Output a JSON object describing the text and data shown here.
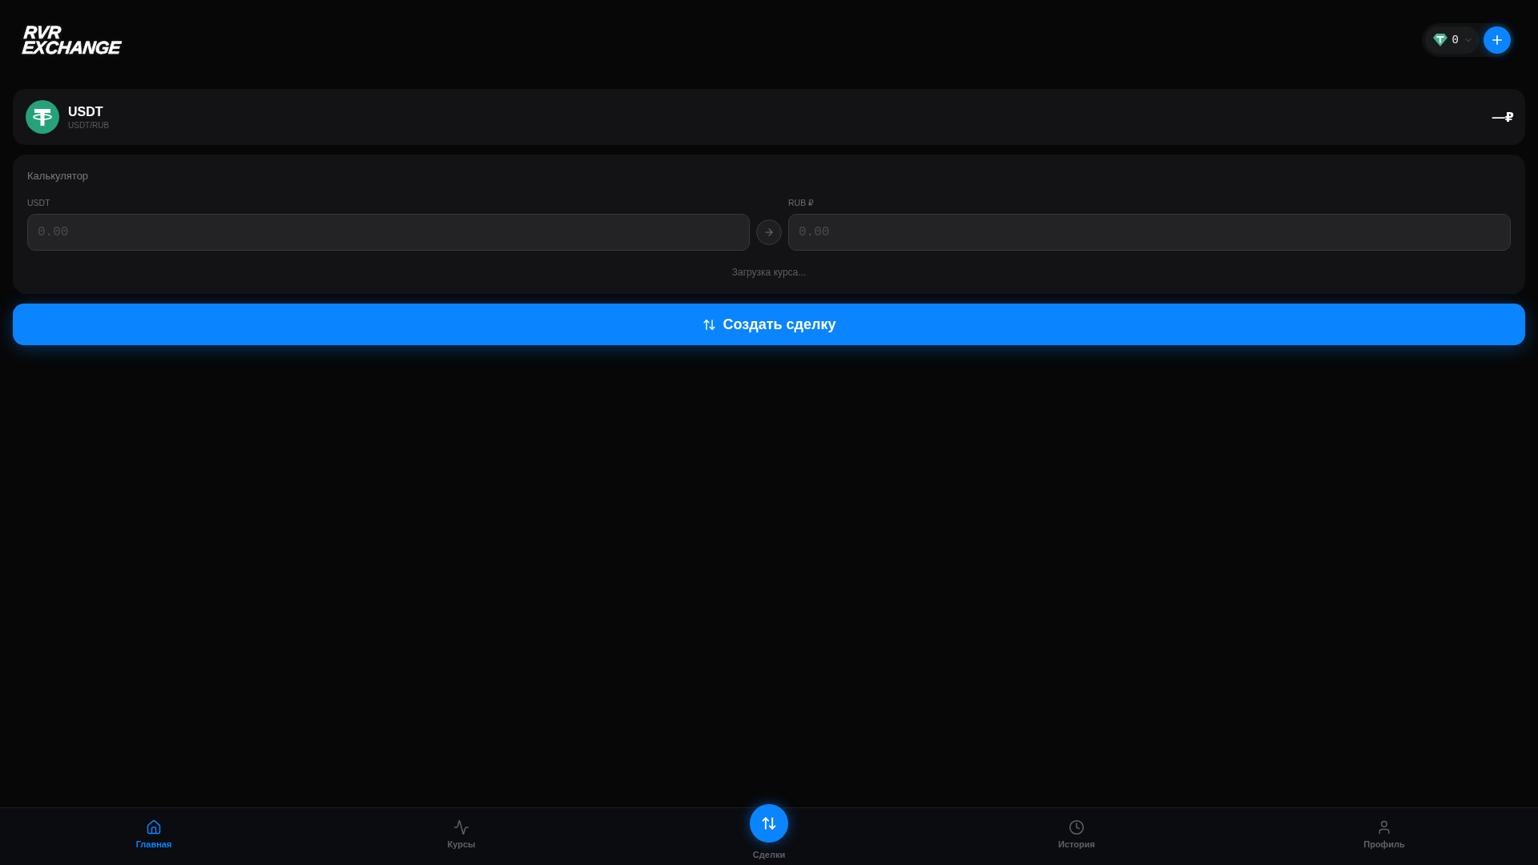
{
  "header": {
    "logo": [
      "RVR",
      "EXCHANGE"
    ],
    "balance": "0"
  },
  "pair": {
    "symbol": "USDT",
    "subtitle": "USDT/RUB",
    "rate": "—₽"
  },
  "calculator": {
    "title": "Калькулятор",
    "fields": [
      {
        "label": "USDT",
        "placeholder": "0.00"
      },
      {
        "label": "RUB ₽",
        "placeholder": "0.00"
      }
    ],
    "status": "Загрузка курса..."
  },
  "create_button": "Создать сделку",
  "bottom_nav": [
    {
      "label": "Главная",
      "kind": "tab",
      "selected": true
    },
    {
      "label": "Курсы",
      "kind": "tab",
      "selected": false
    },
    {
      "label": "Сделки",
      "kind": "action",
      "selected": false
    },
    {
      "label": "История",
      "kind": "tab",
      "selected": false
    },
    {
      "label": "Профиль",
      "kind": "tab",
      "selected": false
    }
  ]
}
